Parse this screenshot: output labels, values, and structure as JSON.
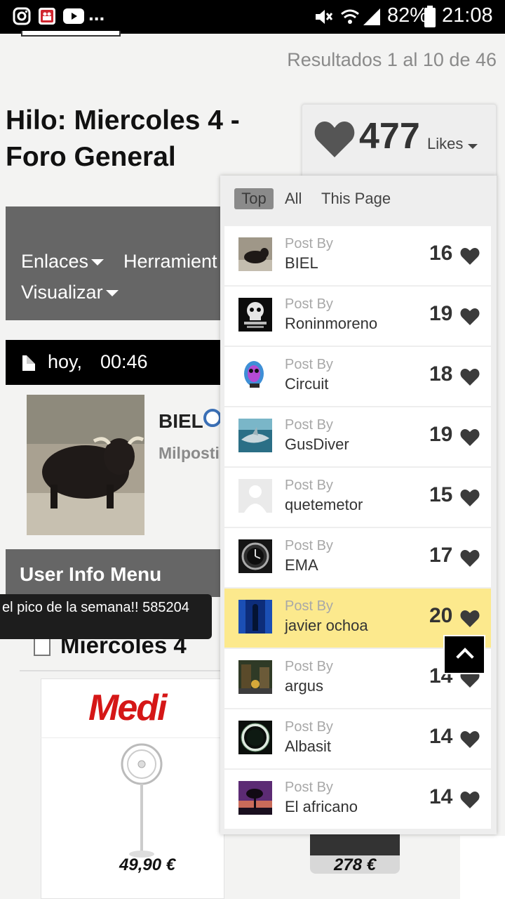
{
  "status_bar": {
    "battery": "82%",
    "time": "21:08",
    "overflow": "..."
  },
  "results_text": "Resultados 1 al 10 de 46",
  "thread_title": "Hilo: Miercoles 4 - Foro General",
  "nav": {
    "links": [
      "Enlaces",
      "Herramient",
      "Visualizar"
    ]
  },
  "post_date": {
    "day": "hoy,",
    "time": "00:46"
  },
  "post_user": {
    "name": "BIEL",
    "title": "Milposti"
  },
  "user_info_menu": "User Info Menu",
  "tooltip_text": "el pico de la semana!! 585204",
  "post_heading": "Miercoles 4",
  "ad": {
    "brand": "Medi",
    "price_left": "49,90 €",
    "price_right": "278 €"
  },
  "likes": {
    "count": "477",
    "label": "Likes",
    "tabs": [
      "Top",
      "All",
      "This Page"
    ],
    "active_tab": "Top",
    "post_by_label": "Post By",
    "rows": [
      {
        "name": "BIEL",
        "count": "16",
        "thumb": "bull-thumb",
        "highlight": false
      },
      {
        "name": "Roninmoreno",
        "count": "19",
        "thumb": "skull-thumb",
        "highlight": false
      },
      {
        "name": "Circuit",
        "count": "18",
        "thumb": "mask-thumb",
        "highlight": false
      },
      {
        "name": "GusDiver",
        "count": "19",
        "thumb": "shark-thumb",
        "highlight": false
      },
      {
        "name": "quetemetor",
        "count": "15",
        "thumb": "default-avatar-thumb",
        "highlight": false
      },
      {
        "name": "EMA",
        "count": "17",
        "thumb": "watch-thumb",
        "highlight": false
      },
      {
        "name": "javier ochoa",
        "count": "20",
        "thumb": "blue-figure-thumb",
        "highlight": true
      },
      {
        "name": "argus",
        "count": "14",
        "thumb": "street-thumb",
        "highlight": false
      },
      {
        "name": "Albasit",
        "count": "14",
        "thumb": "ring-thumb",
        "highlight": false
      },
      {
        "name": "El africano",
        "count": "14",
        "thumb": "tree-sunset-thumb",
        "highlight": false
      }
    ]
  },
  "colors": {
    "highlight_row": "#fce98d",
    "nav_bg": "#666666",
    "brand_red": "#d51717"
  }
}
